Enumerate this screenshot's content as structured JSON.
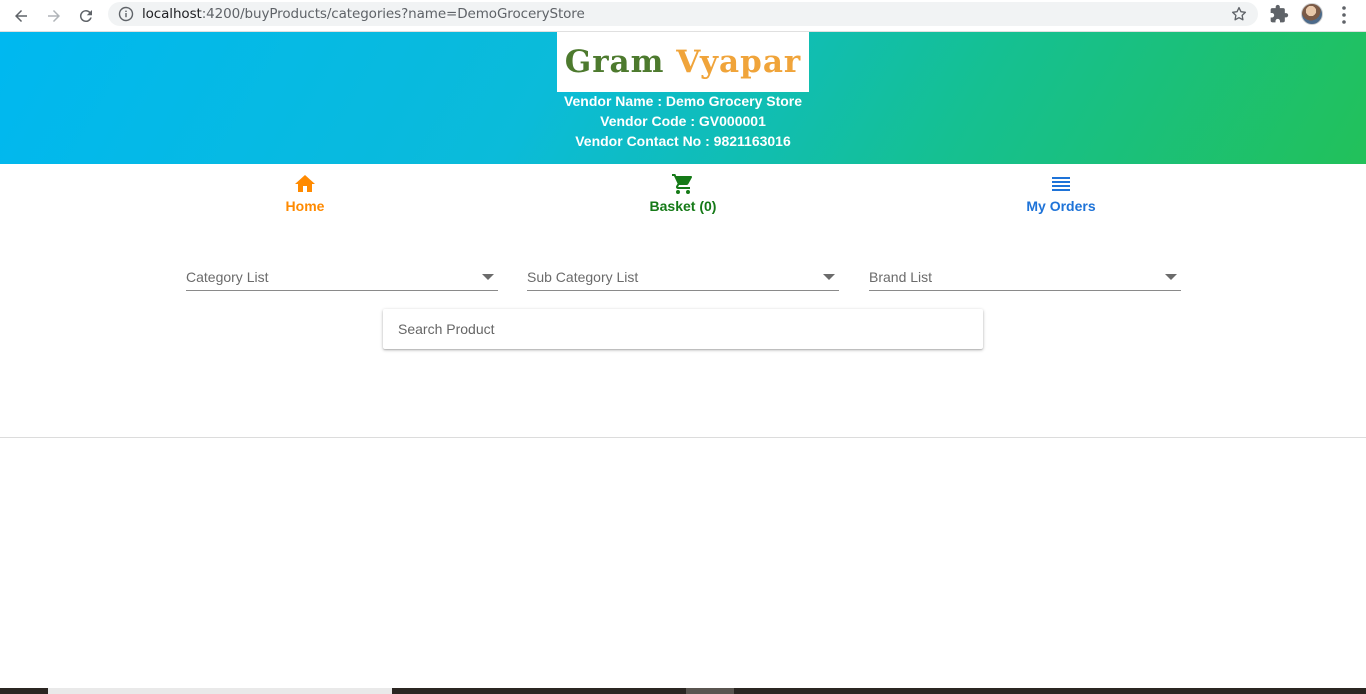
{
  "browser": {
    "url_host": "localhost",
    "url_rest": ":4200/buyProducts/categories?name=DemoGroceryStore"
  },
  "logo": {
    "word1": "Gram",
    "word2": "Vyapar"
  },
  "vendor": {
    "name_line": "Vendor Name : Demo Grocery Store",
    "code_line": "Vendor Code : GV000001",
    "contact_line": "Vendor Contact No : 9821163016"
  },
  "tabs": [
    {
      "label": "Home",
      "icon": "home-icon",
      "color": "#ff8a00"
    },
    {
      "label": "Basket (0)",
      "icon": "cart-icon",
      "color": "#157a17"
    },
    {
      "label": "My Orders",
      "icon": "list-icon",
      "color": "#1e73d8"
    }
  ],
  "filters": {
    "category_placeholder": "Category List",
    "subcategory_placeholder": "Sub Category List",
    "brand_placeholder": "Brand List"
  },
  "search": {
    "placeholder": "Search Product"
  },
  "colors": {
    "banner_start": "#00b8f0",
    "banner_end": "#22c15a"
  }
}
